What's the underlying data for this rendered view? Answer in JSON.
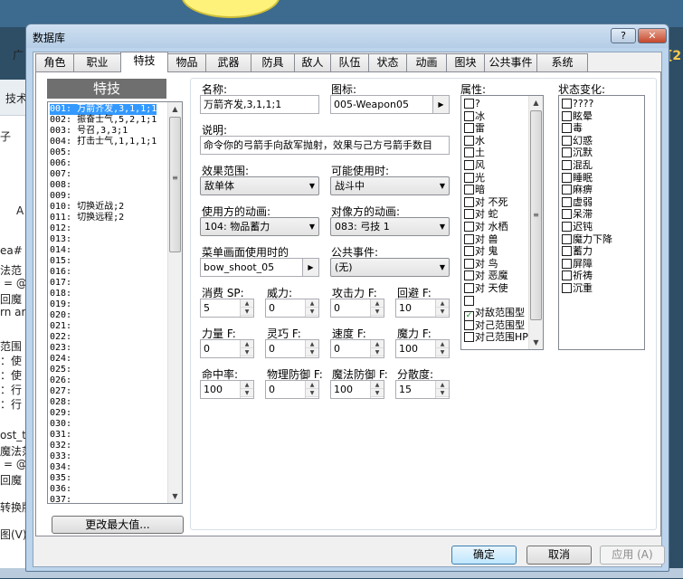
{
  "background": {
    "left_texts": [
      "广",
      "技术",
      "子",
      "A",
      "ea#",
      "法范",
      " = @",
      "回魔",
      "rn ar",
      "范围",
      "：使",
      "：使",
      "：行",
      "：行",
      "ost_t",
      "魔法范",
      " = @",
      "回魔",
      "转换版",
      "图(V)"
    ],
    "right_text": "[2"
  },
  "window": {
    "title": "数据库",
    "help_label": "?",
    "close_label": "✕"
  },
  "tabs": [
    "角色",
    "职业",
    "特技",
    "物品",
    "武器",
    "防具",
    "敌人",
    "队伍",
    "状态",
    "动画",
    "图块",
    "公共事件",
    "系统"
  ],
  "skill_list": {
    "header": "特技",
    "items": [
      "001: 万箭齐发,3,1,1;1",
      "002: 振奋士气,5,2,1;1",
      "003: 号召,3,3;1",
      "004: 打击士气,1,1,1;1",
      "005:",
      "006:",
      "007:",
      "008:",
      "009:",
      "010: 切换近战;2",
      "011: 切换远程;2",
      "012:",
      "013:",
      "014:",
      "015:",
      "016:",
      "017:",
      "018:",
      "019:",
      "020:",
      "021:",
      "022:",
      "023:",
      "024:",
      "025:",
      "026:",
      "027:",
      "028:",
      "029:",
      "030:",
      "031:",
      "032:",
      "033:",
      "034:",
      "035:",
      "036:",
      "037:"
    ],
    "change_max_label": "更改最大值..."
  },
  "form": {
    "name_label": "名称:",
    "name_value": "万箭齐发,3,1,1;1",
    "icon_label": "图标:",
    "icon_value": "005-Weapon05",
    "description_label": "说明:",
    "description_value": "命令你的弓箭手向敌军抛射，效果与己方弓箭手数目",
    "scope_label": "效果范围:",
    "scope_value": "敌单体",
    "occasion_label": "可能使用时:",
    "occasion_value": "战斗中",
    "user_anim_label": "使用方的动画:",
    "user_anim_value": "104: 物品蓄力",
    "target_anim_label": "对像方的动画:",
    "target_anim_value": "083: 弓技 1",
    "menu_se_label": "菜单画面使用时的",
    "menu_se_value": "bow_shoot_05",
    "common_event_label": "公共事件:",
    "common_event_value": "(无)",
    "stats": [
      {
        "label": "消费 SP:",
        "value": "5"
      },
      {
        "label": "威力:",
        "value": "0"
      },
      {
        "label": "攻击力 F:",
        "value": "0"
      },
      {
        "label": "回避 F:",
        "value": "10"
      },
      {
        "label": "力量 F:",
        "value": "0"
      },
      {
        "label": "灵巧 F:",
        "value": "0"
      },
      {
        "label": "速度 F:",
        "value": "0"
      },
      {
        "label": "魔力 F:",
        "value": "100"
      },
      {
        "label": "命中率:",
        "value": "100"
      },
      {
        "label": "物理防御 F:",
        "value": "0"
      },
      {
        "label": "魔法防御 F:",
        "value": "100"
      },
      {
        "label": "分散度:",
        "value": "15"
      }
    ]
  },
  "attributes": {
    "label": "属性:",
    "items": [
      {
        "text": "?",
        "checked": false
      },
      {
        "text": "冰",
        "checked": false
      },
      {
        "text": "雷",
        "checked": false
      },
      {
        "text": "水",
        "checked": false
      },
      {
        "text": "土",
        "checked": false
      },
      {
        "text": "风",
        "checked": false
      },
      {
        "text": "光",
        "checked": false
      },
      {
        "text": "暗",
        "checked": false
      },
      {
        "text": "对 不死",
        "checked": false
      },
      {
        "text": "对 蛇",
        "checked": false
      },
      {
        "text": "对 水栖",
        "checked": false
      },
      {
        "text": "对 兽",
        "checked": false
      },
      {
        "text": "对 鬼",
        "checked": false
      },
      {
        "text": "对 鸟",
        "checked": false
      },
      {
        "text": "对 恶魔",
        "checked": false
      },
      {
        "text": "对 天使",
        "checked": false
      },
      {
        "text": "",
        "checked": false
      },
      {
        "text": "对敌范围型",
        "checked": true
      },
      {
        "text": "对己范围型",
        "checked": false
      },
      {
        "text": "对己范围HP",
        "checked": false
      }
    ]
  },
  "states": {
    "label": "状态变化:",
    "items": [
      "????",
      "眩晕",
      "毒",
      "幻惑",
      "沉默",
      "混乱",
      "睡眠",
      "麻痹",
      "虚弱",
      "呆滞",
      "迟钝",
      "魔力下降",
      "蓄力",
      "屏障",
      "祈祷",
      "沉重"
    ]
  },
  "buttons": {
    "ok": "确定",
    "cancel": "取消",
    "apply": "应用 (A)"
  }
}
